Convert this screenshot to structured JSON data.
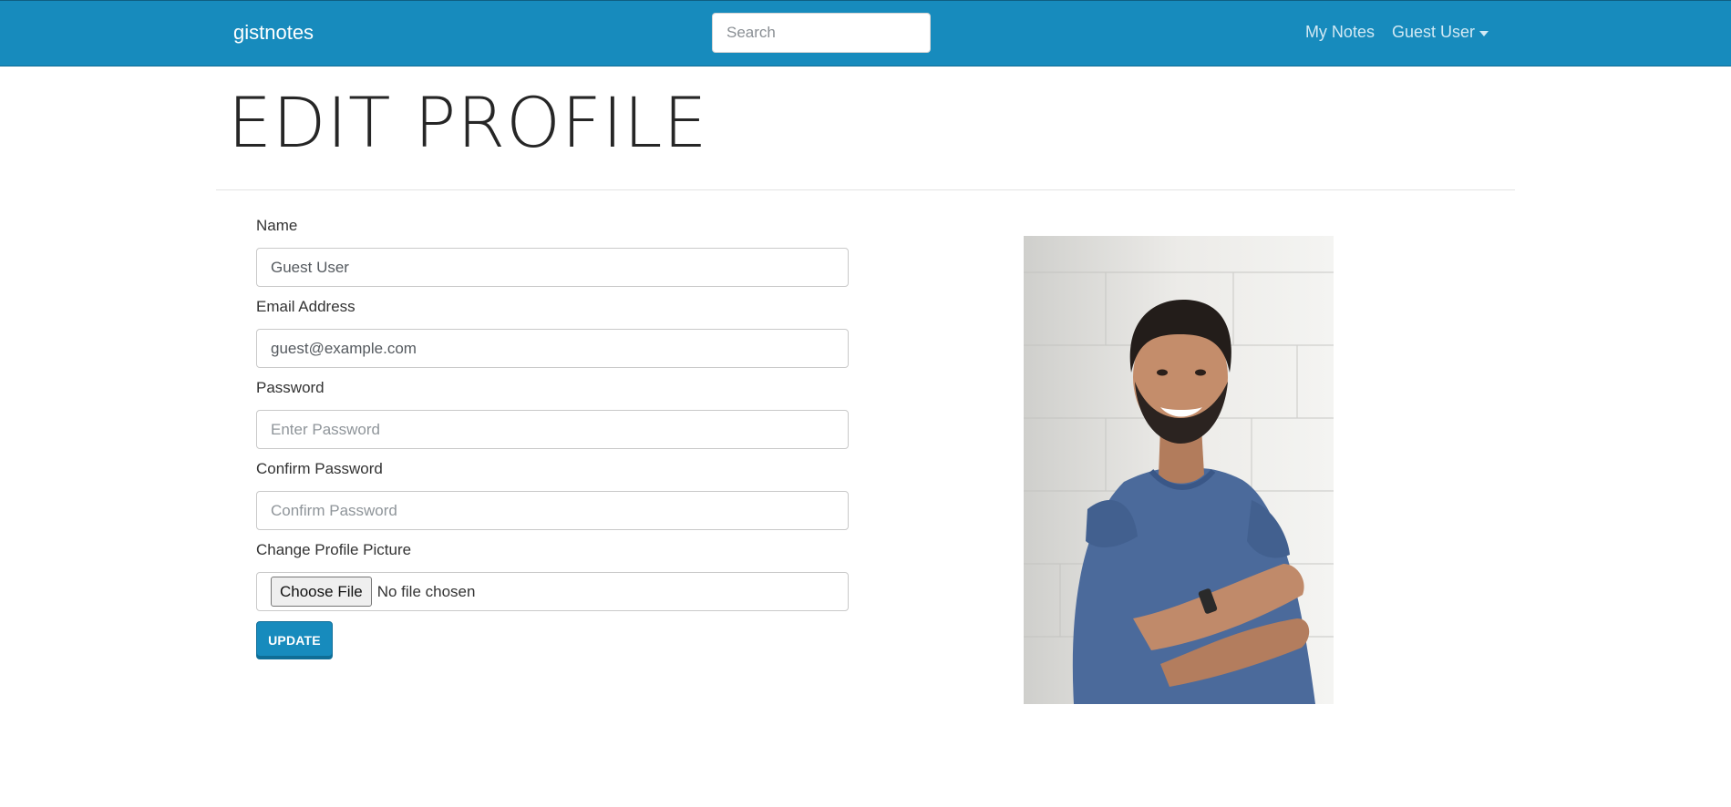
{
  "navbar": {
    "brand": "gistnotes",
    "search_placeholder": "Search",
    "my_notes_label": "My Notes",
    "user_menu_label": "Guest User"
  },
  "page": {
    "title": "EDIT PROFILE"
  },
  "form": {
    "name_label": "Name",
    "name_value": "Guest User",
    "email_label": "Email Address",
    "email_value": "guest@example.com",
    "password_label": "Password",
    "password_placeholder": "Enter Password",
    "confirm_label": "Confirm Password",
    "confirm_placeholder": "Confirm Password",
    "picture_label": "Change Profile Picture",
    "file_button_label": "Choose File",
    "file_status": "No file chosen",
    "update_label": "UPDATE"
  },
  "colors": {
    "brand": "#178bbd",
    "nav_text": "#d2e9f4",
    "shirt": "#4b6a9b"
  },
  "icons": {
    "user_menu": "chevron-down-icon"
  }
}
